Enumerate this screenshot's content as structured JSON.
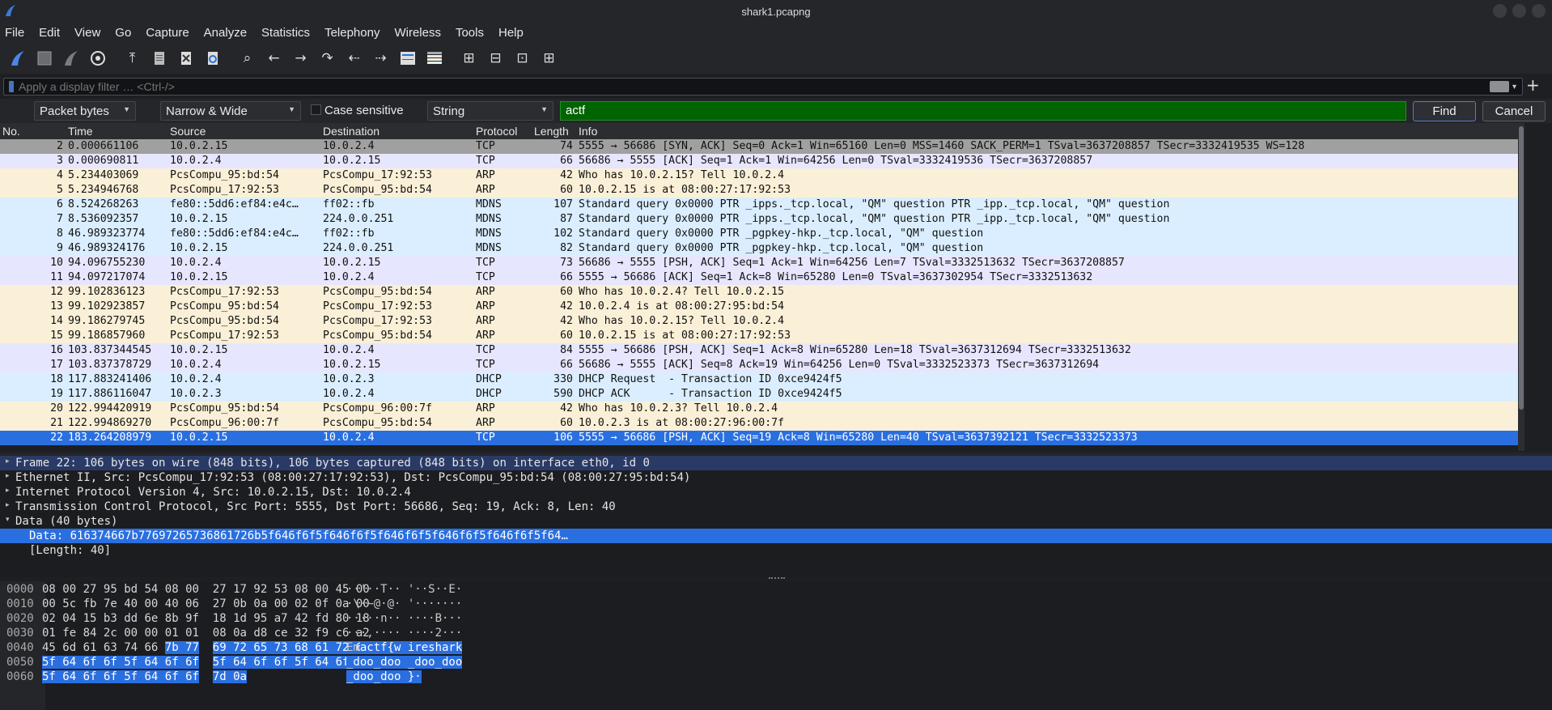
{
  "window": {
    "title": "shark1.pcapng"
  },
  "menu": [
    "File",
    "Edit",
    "View",
    "Go",
    "Capture",
    "Analyze",
    "Statistics",
    "Telephony",
    "Wireless",
    "Tools",
    "Help"
  ],
  "toolbar_icons": [
    "shark-fin-start-icon",
    "stop-icon",
    "restart-icon",
    "options-gear-icon",
    "open-file-icon",
    "file-set-icon",
    "close-file-icon",
    "reload-icon",
    "find-icon",
    "back-arrow-icon",
    "forward-arrow-icon",
    "go-to-packet-icon",
    "first-packet-icon",
    "last-packet-icon",
    "autoscroll-icon",
    "colorize-icon",
    "zoom-in-icon",
    "zoom-out-icon",
    "normal-size-icon",
    "resize-columns-icon"
  ],
  "filter": {
    "placeholder": "Apply a display filter … <Ctrl-/>"
  },
  "findbar": {
    "search_in": "Packet bytes",
    "charset": "Narrow & Wide",
    "case_label": "Case sensitive",
    "type": "String",
    "query": "actf",
    "find_label": "Find",
    "cancel_label": "Cancel"
  },
  "columns": [
    "No.",
    "Time",
    "Source",
    "Destination",
    "Protocol",
    "Length",
    "Info"
  ],
  "packets": [
    {
      "no": "2",
      "time": "0.000661106",
      "src": "10.0.2.15",
      "dst": "10.0.2.4",
      "proto": "TCP",
      "len": "74",
      "info": "5555 → 56686 [SYN, ACK] Seq=0 Ack=1 Win=65160 Len=0 MSS=1460 SACK_PERM=1 TSval=3637208857 TSecr=3332419535 WS=128",
      "color": "#a0a0a0"
    },
    {
      "no": "3",
      "time": "0.000690811",
      "src": "10.0.2.4",
      "dst": "10.0.2.15",
      "proto": "TCP",
      "len": "66",
      "info": "56686 → 5555 [ACK] Seq=1 Ack=1 Win=64256 Len=0 TSval=3332419536 TSecr=3637208857",
      "color": "#e7e6ff"
    },
    {
      "no": "4",
      "time": "5.234403069",
      "src": "PcsCompu_95:bd:54",
      "dst": "PcsCompu_17:92:53",
      "proto": "ARP",
      "len": "42",
      "info": "Who has 10.0.2.15? Tell 10.0.2.4",
      "color": "#faf0d7"
    },
    {
      "no": "5",
      "time": "5.234946768",
      "src": "PcsCompu_17:92:53",
      "dst": "PcsCompu_95:bd:54",
      "proto": "ARP",
      "len": "60",
      "info": "10.0.2.15 is at 08:00:27:17:92:53",
      "color": "#faf0d7"
    },
    {
      "no": "6",
      "time": "8.524268263",
      "src": "fe80::5dd6:ef84:e4c…",
      "dst": "ff02::fb",
      "proto": "MDNS",
      "len": "107",
      "info": "Standard query 0x0000 PTR _ipps._tcp.local, \"QM\" question PTR _ipp._tcp.local, \"QM\" question",
      "color": "#daeeff"
    },
    {
      "no": "7",
      "time": "8.536092357",
      "src": "10.0.2.15",
      "dst": "224.0.0.251",
      "proto": "MDNS",
      "len": "87",
      "info": "Standard query 0x0000 PTR _ipps._tcp.local, \"QM\" question PTR _ipp._tcp.local, \"QM\" question",
      "color": "#daeeff"
    },
    {
      "no": "8",
      "time": "46.989323774",
      "src": "fe80::5dd6:ef84:e4c…",
      "dst": "ff02::fb",
      "proto": "MDNS",
      "len": "102",
      "info": "Standard query 0x0000 PTR _pgpkey-hkp._tcp.local, \"QM\" question",
      "color": "#daeeff"
    },
    {
      "no": "9",
      "time": "46.989324176",
      "src": "10.0.2.15",
      "dst": "224.0.0.251",
      "proto": "MDNS",
      "len": "82",
      "info": "Standard query 0x0000 PTR _pgpkey-hkp._tcp.local, \"QM\" question",
      "color": "#daeeff"
    },
    {
      "no": "10",
      "time": "94.096755230",
      "src": "10.0.2.4",
      "dst": "10.0.2.15",
      "proto": "TCP",
      "len": "73",
      "info": "56686 → 5555 [PSH, ACK] Seq=1 Ack=1 Win=64256 Len=7 TSval=3332513632 TSecr=3637208857",
      "color": "#e7e6ff"
    },
    {
      "no": "11",
      "time": "94.097217074",
      "src": "10.0.2.15",
      "dst": "10.0.2.4",
      "proto": "TCP",
      "len": "66",
      "info": "5555 → 56686 [ACK] Seq=1 Ack=8 Win=65280 Len=0 TSval=3637302954 TSecr=3332513632",
      "color": "#e7e6ff"
    },
    {
      "no": "12",
      "time": "99.102836123",
      "src": "PcsCompu_17:92:53",
      "dst": "PcsCompu_95:bd:54",
      "proto": "ARP",
      "len": "60",
      "info": "Who has 10.0.2.4? Tell 10.0.2.15",
      "color": "#faf0d7"
    },
    {
      "no": "13",
      "time": "99.102923857",
      "src": "PcsCompu_95:bd:54",
      "dst": "PcsCompu_17:92:53",
      "proto": "ARP",
      "len": "42",
      "info": "10.0.2.4 is at 08:00:27:95:bd:54",
      "color": "#faf0d7"
    },
    {
      "no": "14",
      "time": "99.186279745",
      "src": "PcsCompu_95:bd:54",
      "dst": "PcsCompu_17:92:53",
      "proto": "ARP",
      "len": "42",
      "info": "Who has 10.0.2.15? Tell 10.0.2.4",
      "color": "#faf0d7"
    },
    {
      "no": "15",
      "time": "99.186857960",
      "src": "PcsCompu_17:92:53",
      "dst": "PcsCompu_95:bd:54",
      "proto": "ARP",
      "len": "60",
      "info": "10.0.2.15 is at 08:00:27:17:92:53",
      "color": "#faf0d7"
    },
    {
      "no": "16",
      "time": "103.837344545",
      "src": "10.0.2.15",
      "dst": "10.0.2.4",
      "proto": "TCP",
      "len": "84",
      "info": "5555 → 56686 [PSH, ACK] Seq=1 Ack=8 Win=65280 Len=18 TSval=3637312694 TSecr=3332513632",
      "color": "#e7e6ff"
    },
    {
      "no": "17",
      "time": "103.837378729",
      "src": "10.0.2.4",
      "dst": "10.0.2.15",
      "proto": "TCP",
      "len": "66",
      "info": "56686 → 5555 [ACK] Seq=8 Ack=19 Win=64256 Len=0 TSval=3332523373 TSecr=3637312694",
      "color": "#e7e6ff"
    },
    {
      "no": "18",
      "time": "117.883241406",
      "src": "10.0.2.4",
      "dst": "10.0.2.3",
      "proto": "DHCP",
      "len": "330",
      "info": "DHCP Request  - Transaction ID 0xce9424f5",
      "color": "#daeeff"
    },
    {
      "no": "19",
      "time": "117.886116047",
      "src": "10.0.2.3",
      "dst": "10.0.2.4",
      "proto": "DHCP",
      "len": "590",
      "info": "DHCP ACK      - Transaction ID 0xce9424f5",
      "color": "#daeeff"
    },
    {
      "no": "20",
      "time": "122.994420919",
      "src": "PcsCompu_95:bd:54",
      "dst": "PcsCompu_96:00:7f",
      "proto": "ARP",
      "len": "42",
      "info": "Who has 10.0.2.3? Tell 10.0.2.4",
      "color": "#faf0d7"
    },
    {
      "no": "21",
      "time": "122.994869270",
      "src": "PcsCompu_96:00:7f",
      "dst": "PcsCompu_95:bd:54",
      "proto": "ARP",
      "len": "60",
      "info": "10.0.2.3 is at 08:00:27:96:00:7f",
      "color": "#faf0d7"
    },
    {
      "no": "22",
      "time": "183.264208979",
      "src": "10.0.2.15",
      "dst": "10.0.2.4",
      "proto": "TCP",
      "len": "106",
      "info": "5555 → 56686 [PSH, ACK] Seq=19 Ack=8 Win=65280 Len=40 TSval=3637392121 TSecr=3332523373",
      "color": "#2a6fe0",
      "selected": true
    }
  ],
  "details": [
    {
      "text": "Frame 22: 106 bytes on wire (848 bits), 106 bytes captured (848 bits) on interface eth0, id 0",
      "twisty": "▸",
      "level": 0,
      "style": "sel1"
    },
    {
      "text": "Ethernet II, Src: PcsCompu_17:92:53 (08:00:27:17:92:53), Dst: PcsCompu_95:bd:54 (08:00:27:95:bd:54)",
      "twisty": "▸",
      "level": 0
    },
    {
      "text": "Internet Protocol Version 4, Src: 10.0.2.15, Dst: 10.0.2.4",
      "twisty": "▸",
      "level": 0
    },
    {
      "text": "Transmission Control Protocol, Src Port: 5555, Dst Port: 56686, Seq: 19, Ack: 8, Len: 40",
      "twisty": "▸",
      "level": 0
    },
    {
      "text": "Data (40 bytes)",
      "twisty": "▾",
      "level": 0
    },
    {
      "text": "Data: 616374667b77697265736861726b5f646f6f5f646f6f5f646f6f5f646f6f5f646f6f5f64…",
      "twisty": "",
      "level": 1,
      "style": "sel2"
    },
    {
      "text": "[Length: 40]",
      "twisty": "",
      "level": 1
    }
  ],
  "bytes": [
    {
      "off": "0000",
      "hex": "08 00 27 95 bd 54 08 00  27 17 92 53 08 00 45 00",
      "ascii": "··'··T·· '··S··E·",
      "hl_hex_from": null,
      "hl_ascii_from": null
    },
    {
      "off": "0010",
      "hex": "00 5c fb 7e 40 00 40 06  27 0b 0a 00 02 0f 0a 00",
      "ascii": "·\\·~@·@· '·······",
      "hl_hex_from": null,
      "hl_ascii_from": null
    },
    {
      "off": "0020",
      "hex": "02 04 15 b3 dd 6e 8b 9f  18 1d 95 a7 42 fd 80 18",
      "ascii": "·····n·· ····B···",
      "hl_hex_from": null,
      "hl_ascii_from": null
    },
    {
      "off": "0030",
      "hex": "01 fe 84 2c 00 00 01 01  08 0a d8 ce 32 f9 c6 a2",
      "ascii": "···,···· ····2···",
      "hl_hex_from": null,
      "hl_ascii_from": null
    },
    {
      "off": "0040",
      "hex": "45 6d 61 63 74 66 7b 77  69 72 65 73 68 61 72 6b",
      "ascii": "Emactf{w ireshark",
      "hl_hex_from": 6,
      "hl_ascii_from": 2
    },
    {
      "off": "0050",
      "hex": "5f 64 6f 6f 5f 64 6f 6f  5f 64 6f 6f 5f 64 6f 6f",
      "ascii": "_doo_doo _doo_doo",
      "hl_hex_from": 0,
      "hl_ascii_from": 0
    },
    {
      "off": "0060",
      "hex": "5f 64 6f 6f 5f 64 6f 6f  7d 0a",
      "ascii": "_doo_doo }·",
      "hl_hex_from": 0,
      "hl_ascii_from": 0
    }
  ]
}
